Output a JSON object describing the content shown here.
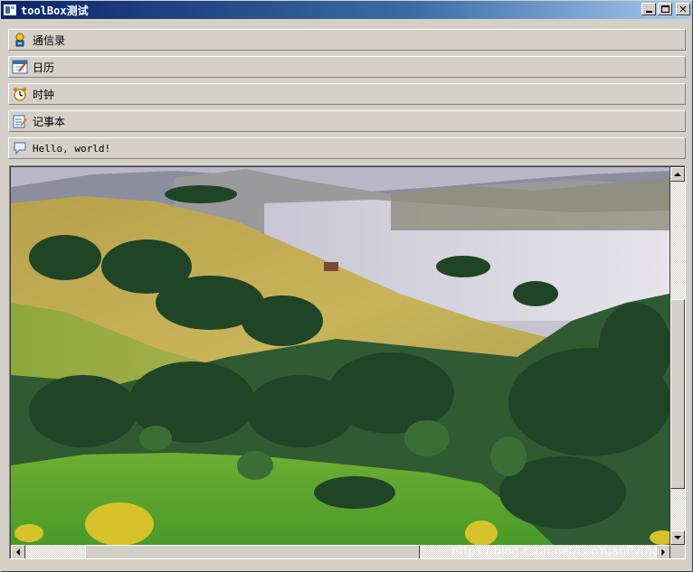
{
  "window": {
    "title": "toolBox测试",
    "minimize": "minimize",
    "maximize": "maximize",
    "close": "✕"
  },
  "toolbox": {
    "items": [
      {
        "label": "通信录",
        "icon": "contacts-icon"
      },
      {
        "label": "日历",
        "icon": "calendar-icon"
      },
      {
        "label": "时钟",
        "icon": "clock-icon"
      },
      {
        "label": "记事本",
        "icon": "notepad-icon"
      },
      {
        "label": "Hello, world!",
        "icon": "speech-bubble-icon"
      }
    ]
  },
  "image_view": {
    "subject": "landscape-photo",
    "vscroll_position": 0.33,
    "hscroll_position": 0.0
  },
  "watermark": "https://blog.csdn.net/LaoYuanPython",
  "colors": {
    "face": "#d4d0c8",
    "title_start": "#0a246a",
    "title_end": "#a6caf0"
  }
}
